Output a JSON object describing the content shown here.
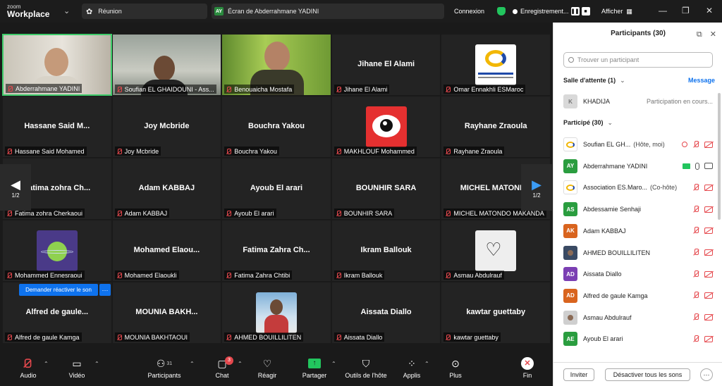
{
  "titlebar": {
    "brand_top": "zoom",
    "brand_main": "Workplace",
    "meeting_label": "Réunion",
    "share_badge": "AY",
    "share_label": "Écran de Abderrahmane YADINI",
    "connection": "Connexion",
    "recording": "Enregistrement...",
    "view": "Afficher"
  },
  "tiles": [
    {
      "label": "Abderrahmane YADINI",
      "center": "",
      "kind": "video1"
    },
    {
      "label": "Soufian EL GHAIDOUNI - Ass...",
      "center": "",
      "kind": "video2"
    },
    {
      "label": "Benouaicha Mostafa",
      "center": "",
      "kind": "video3"
    },
    {
      "label": "Jihane El Alami",
      "center": "Jihane El Alami",
      "kind": "name"
    },
    {
      "label": "Omar Ennakhli ESMaroc",
      "center": "",
      "kind": "logo-es"
    },
    {
      "label": "Hassane Said Mohamed",
      "center": "Hassane  Said  M...",
      "kind": "name"
    },
    {
      "label": "Joy Mcbride",
      "center": "Joy Mcbride",
      "kind": "name"
    },
    {
      "label": "Bouchra Yakou",
      "center": "Bouchra Yakou",
      "kind": "name"
    },
    {
      "label": "MAKHLOUF Mohammed",
      "center": "",
      "kind": "logo-eye"
    },
    {
      "label": "Rayhane Zraoula",
      "center": "Rayhane Zraoula",
      "kind": "name"
    },
    {
      "label": "Fatima zohra Cherkaoui",
      "center": "Fatima zohra Ch...",
      "kind": "name"
    },
    {
      "label": "Adam KABBAJ",
      "center": "Adam  KABBAJ",
      "kind": "name"
    },
    {
      "label": "Ayoub El arari",
      "center": "Ayoub El arari",
      "kind": "name"
    },
    {
      "label": "BOUNHIR SARA",
      "center": "BOUNHIR SARA",
      "kind": "name"
    },
    {
      "label": "MICHEL MATONDO MAKANDA",
      "center": "MICHEL  MATONDO",
      "kind": "name"
    },
    {
      "label": "Mohammed Ennesraoui",
      "center": "",
      "kind": "logo-planet"
    },
    {
      "label": "Mohamed Elaoukli",
      "center": "Mohamed  Elaou...",
      "kind": "name"
    },
    {
      "label": "Fatima Zahra Chtibi",
      "center": "Fatima Zahra Ch...",
      "kind": "name"
    },
    {
      "label": "Ikram Ballouk",
      "center": "Ikram Ballouk",
      "kind": "name"
    },
    {
      "label": "Asmau Abdulrauf",
      "center": "",
      "kind": "logo-heart"
    },
    {
      "label": "Alfred de gaule Kamga",
      "center": "Alfred  de  gaule...",
      "kind": "name"
    },
    {
      "label": "MOUNIA BAKHTAOUI",
      "center": "MOUNIA  BAKH...",
      "kind": "name"
    },
    {
      "label": "AHMED BOUILLILITEN",
      "center": "",
      "kind": "photo"
    },
    {
      "label": "Aissata Diallo",
      "center": "Aissata Diallo",
      "kind": "name"
    },
    {
      "label": "kawtar guettaby",
      "center": "kawtar guettaby",
      "kind": "name"
    }
  ],
  "nav": {
    "page": "1/2"
  },
  "reenable": {
    "label": "Demander réactiver le son",
    "more": "···"
  },
  "toolbar": {
    "audio": "Audio",
    "video": "Vidéo",
    "participants": "Participants",
    "participants_count": "31",
    "chat": "Chat",
    "chat_badge": "3",
    "react": "Réagir",
    "share": "Partager",
    "host_tools": "Outils de l'hôte",
    "apps": "Applis",
    "more": "Plus",
    "end": "Fin"
  },
  "panel": {
    "title": "Participants (30)",
    "search_placeholder": "Trouver un participant",
    "waiting_title": "Salle d'attente (1)",
    "message_link": "Message",
    "waiting": {
      "initial": "K",
      "name": "KHADIJA",
      "status": "Participation en cours..."
    },
    "joined_title": "Participé (30)",
    "participants": [
      {
        "initial": "",
        "name": "Soufian EL GH...",
        "role": "(Hôte, moi)",
        "color": "#ffffff",
        "kind": "logo"
      },
      {
        "initial": "AY",
        "name": "Abderrahmane YADINI",
        "role": "",
        "color": "#2a9d3f",
        "kind": "active"
      },
      {
        "initial": "",
        "name": "Association ES.Maro...",
        "role": "(Co-hôte)",
        "color": "#ffffff",
        "kind": "logo"
      },
      {
        "initial": "AS",
        "name": "Abdessamie Senhaji",
        "role": "",
        "color": "#2a9d3f",
        "kind": "muted"
      },
      {
        "initial": "AK",
        "name": "Adam KABBAJ",
        "role": "",
        "color": "#d9641e",
        "kind": "muted"
      },
      {
        "initial": "",
        "name": "AHMED BOUILLILITEN",
        "role": "",
        "color": "#3a4a63",
        "kind": "photo"
      },
      {
        "initial": "AD",
        "name": "Aissata Diallo",
        "role": "",
        "color": "#7b3fb3",
        "kind": "muted"
      },
      {
        "initial": "AD",
        "name": "Alfred de gaule Kamga",
        "role": "",
        "color": "#d9641e",
        "kind": "muted"
      },
      {
        "initial": "",
        "name": "Asmau Abdulrauf",
        "role": "",
        "color": "#cfcfcf",
        "kind": "photo"
      },
      {
        "initial": "AE",
        "name": "Ayoub El arari",
        "role": "",
        "color": "#2a9d3f",
        "kind": "muted"
      }
    ],
    "invite": "Inviter",
    "mute_all": "Désactiver tous les sons",
    "more": "···"
  }
}
